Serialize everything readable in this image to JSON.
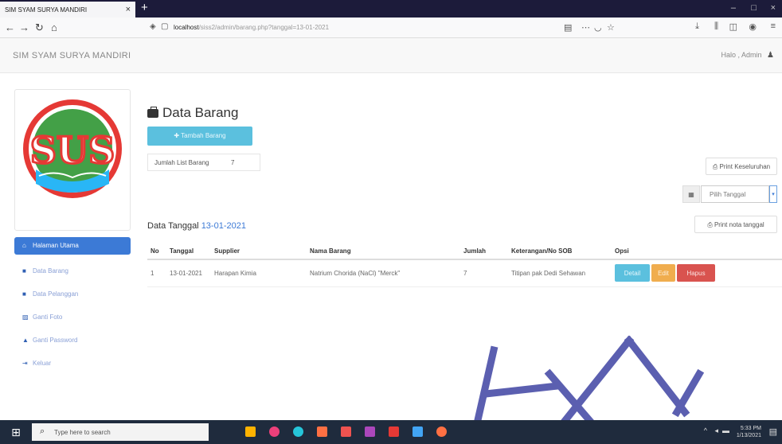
{
  "browser": {
    "tab_title": "SIM SYAM SURYA MANDIRI",
    "new_tab": "+",
    "url_host": "localhost",
    "url_path": "/siss2/admin/barang.php?tanggal=13-01-2021",
    "window_controls": [
      "–",
      "□",
      "×"
    ]
  },
  "app": {
    "brand": "SIM SYAM SURYA MANDIRI",
    "user_greeting": "Halo , Admin"
  },
  "logo": {
    "letters": "SUS"
  },
  "sidebar": {
    "items": [
      {
        "label": "Halaman Utama",
        "icon": "home-icon"
      },
      {
        "label": "Data Barang",
        "icon": "briefcase-icon"
      },
      {
        "label": "Data Pelanggan",
        "icon": "briefcase-icon"
      },
      {
        "label": "Ganti Foto",
        "icon": "image-icon"
      },
      {
        "label": "Ganti Password",
        "icon": "lock-icon"
      },
      {
        "label": "Keluar",
        "icon": "logout-icon"
      }
    ]
  },
  "main": {
    "title": "Data Barang",
    "add_button": "Tambah Barang",
    "count_label": "Jumlah List Barang",
    "count_value": "7",
    "print_all": "Print Keseluruhan",
    "date_placeholder": "Pilih Tanggal",
    "print_date": "Print nota tanggal",
    "date_heading_prefix": "Data Tanggal",
    "date_heading_value": "13-01-2021"
  },
  "table": {
    "headers": [
      "No",
      "Tanggal",
      "Supplier",
      "Nama Barang",
      "Jumlah",
      "Keterangan/No SOB",
      "Opsi"
    ],
    "rows": [
      {
        "no": "1",
        "tanggal": "13-01-2021",
        "supplier": "Harapan Kimia",
        "nama_barang": "Natrium Chorida (NaCl) \"Merck\"",
        "jumlah": "7",
        "keterangan": "Titipan pak Dedi Sehawan"
      }
    ],
    "actions": {
      "detail": "Detail",
      "edit": "Edit",
      "hapus": "Hapus"
    }
  },
  "taskbar": {
    "search_placeholder": "Type here to search",
    "time": "5:33 PM",
    "date": "1/13/2021"
  },
  "colors": {
    "primary": "#3c7ad6",
    "info": "#5bc0de",
    "warning": "#f0ad4e",
    "danger": "#d9534f",
    "logo_red": "#e53935",
    "logo_green": "#43a047"
  }
}
